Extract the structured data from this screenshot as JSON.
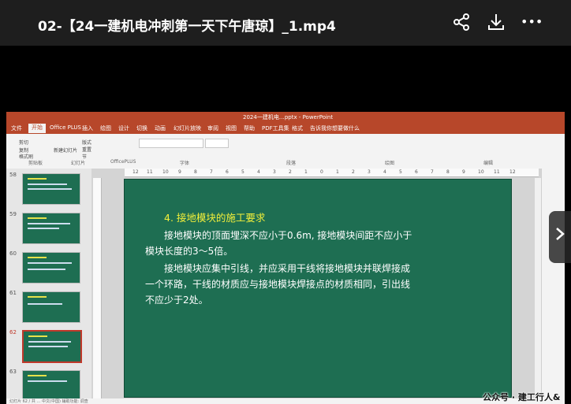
{
  "player": {
    "title": "02-【24一建机电冲刺第一天下午唐琼】_1.mp4",
    "icons": [
      "share-icon",
      "download-icon",
      "more-icon"
    ],
    "more_label": "•••"
  },
  "ppt": {
    "window_title": "2024一建机电…pptx - PowerPoint",
    "tabs": [
      "文件",
      "开始",
      "Office PLUS",
      "插入",
      "绘图",
      "设计",
      "切换",
      "动画",
      "幻灯片放映",
      "审阅",
      "视图",
      "帮助",
      "PDF工具集",
      "格式",
      "告诉我你想要做什么"
    ],
    "ribbon_groups": [
      "剪贴板",
      "幻灯片",
      "OfficePLUS",
      "字体",
      "段落",
      "绘图",
      "编辑"
    ],
    "ribbon_items": [
      "剪切",
      "复制",
      "格式刷",
      "新建幻灯片",
      "版式",
      "重置",
      "节"
    ],
    "slide_numbers": [
      "58",
      "59",
      "60",
      "61",
      "62",
      "63"
    ],
    "selected_slide": "62",
    "ruler_numbers": [
      "12",
      "11",
      "10",
      "9",
      "8",
      "7",
      "6",
      "5",
      "4",
      "3",
      "2",
      "1",
      "0",
      "1",
      "2",
      "3",
      "4",
      "5",
      "6",
      "7",
      "8",
      "9",
      "10",
      "11",
      "12"
    ],
    "slide": {
      "heading": "4. 接地模块的施工要求",
      "lines": [
        "接地模块的顶面埋深不应小于0.6m, 接地模块间距不应小于",
        "模块长度的3～5倍。",
        "接地模块应集中引线，并应采用干线将接地模块并联焊接成",
        "一个环路，干线的材质应与接地模块焊接点的材质相同，引出线",
        "不应少于2处。"
      ]
    },
    "status": "幻灯片 62 / 共 …   中文(中国)   辅助功能: 调查"
  },
  "watermark": "公众号 · 建工行人&",
  "colors": {
    "ppt_accent": "#b7472a",
    "slide_bg": "#1e6e52",
    "heading_yellow": "#f2ef3a"
  }
}
